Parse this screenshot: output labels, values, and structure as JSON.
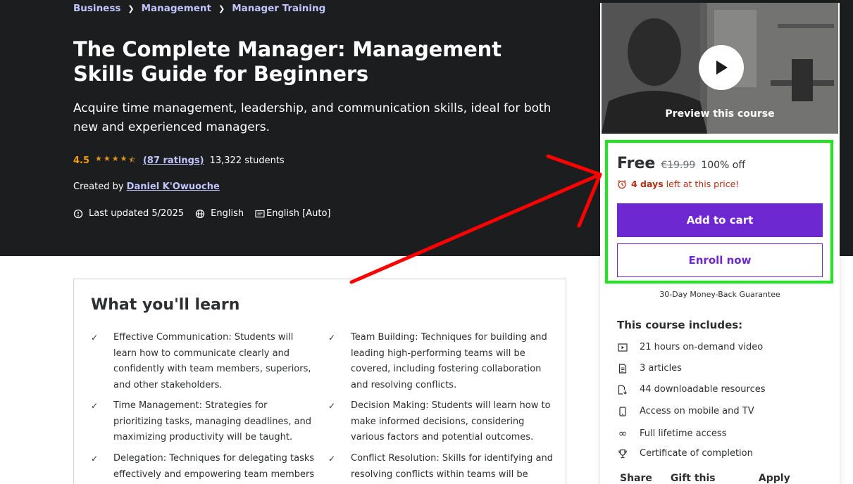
{
  "breadcrumb": [
    "Business",
    "Management",
    "Manager Training"
  ],
  "course": {
    "title": "The Complete Manager: Management Skills Guide for Beginners",
    "subtitle": "Acquire time management, leadership, and communication skills, ideal for both new and experienced managers.",
    "rating": "4.5",
    "rating_stars": 4.5,
    "ratings_count": "(87 ratings)",
    "students": "13,322 students",
    "created_by_label": "Created by",
    "instructor": "Daniel K'Owuoche",
    "last_updated": "Last updated 5/2025",
    "language": "English",
    "captions": "English [Auto]"
  },
  "learn": {
    "title": "What you'll learn",
    "items": [
      "Effective Communication: Students will learn how to communicate clearly and confidently with team members, superiors, and other stakeholders.",
      "Team Building: Techniques for building and leading high-performing teams will be covered, including fostering collaboration and resolving conflicts.",
      "Time Management: Strategies for prioritizing tasks, managing deadlines, and maximizing productivity will be taught.",
      "Decision Making: Students will learn how to make informed decisions, considering various factors and potential outcomes.",
      "Delegation: Techniques for delegating tasks effectively and empowering team members",
      "Conflict Resolution: Skills for identifying and resolving conflicts within teams will be"
    ]
  },
  "sidebar": {
    "preview_label": "Preview this course",
    "price": "Free",
    "old_price": "€19.99",
    "discount": "100% off",
    "timer_bold": "4 days",
    "timer_rest": "left at this price!",
    "add_to_cart": "Add to cart",
    "enroll_now": "Enroll now",
    "guarantee": "30-Day Money-Back Guarantee",
    "includes_title": "This course includes:",
    "includes": [
      {
        "icon": "video-icon",
        "text": "21 hours on-demand video"
      },
      {
        "icon": "article-icon",
        "text": "3 articles"
      },
      {
        "icon": "download-icon",
        "text": "44 downloadable resources"
      },
      {
        "icon": "mobile-icon",
        "text": "Access on mobile and TV"
      },
      {
        "icon": "infinity-icon",
        "text": "Full lifetime access"
      },
      {
        "icon": "trophy-icon",
        "text": "Certificate of completion"
      }
    ],
    "footer": [
      "Share",
      "Gift this course",
      "Apply Coupon"
    ]
  },
  "colors": {
    "hero_bg": "#1c1d1f",
    "link": "#c0c4fc",
    "rating": "#f69c08",
    "primary": "#6d28d2",
    "timer": "#b32d0f",
    "annotation_box": "#1de81d",
    "annotation_arrow": "#ff0000"
  }
}
